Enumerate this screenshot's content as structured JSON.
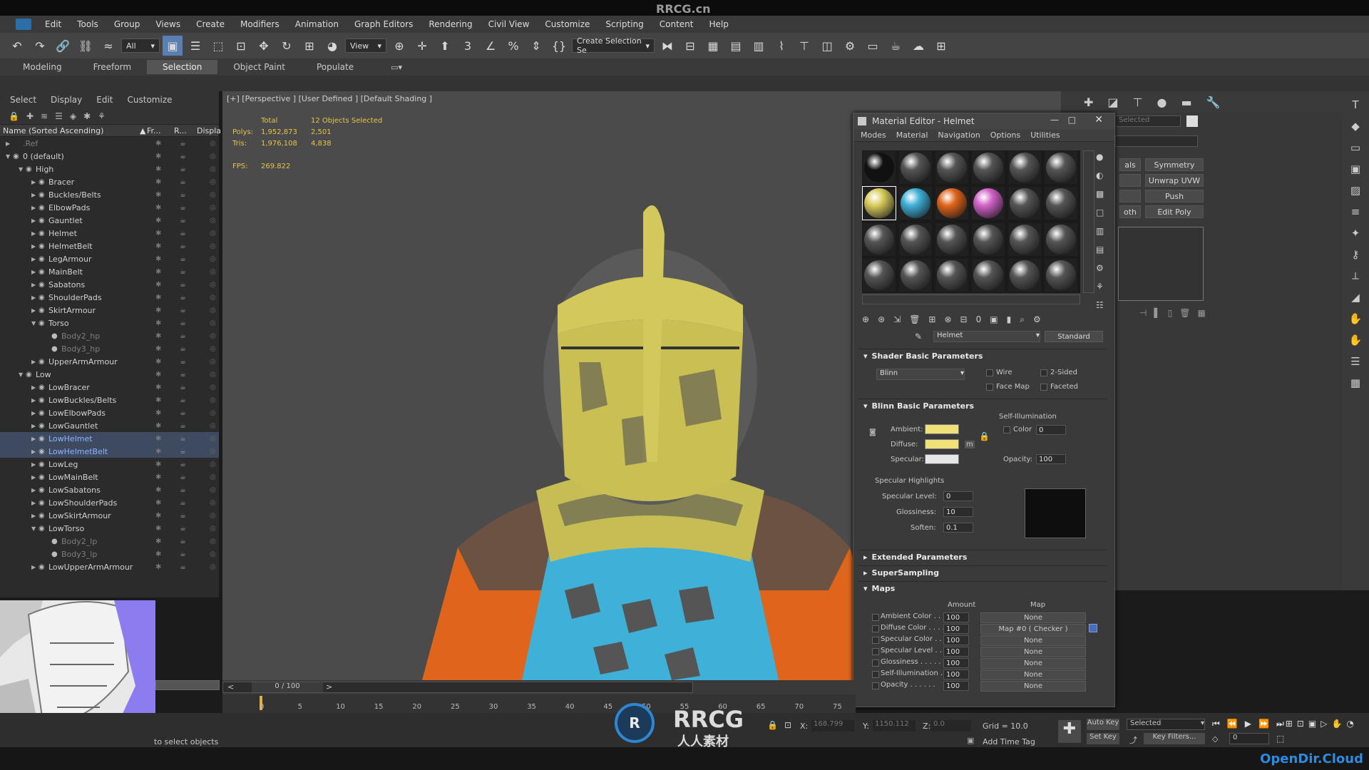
{
  "watermark_top": "RRCG.cn",
  "menubar": [
    "Edit",
    "Tools",
    "Group",
    "Views",
    "Create",
    "Modifiers",
    "Animation",
    "Graph Editors",
    "Rendering",
    "Civil View",
    "Customize",
    "Scripting",
    "Content",
    "Help"
  ],
  "toolbar": {
    "filter_value": "All",
    "view_value": "View",
    "selection_set": "Create Selection Se"
  },
  "ribbon_tabs": [
    "Modeling",
    "Freeform",
    "Selection",
    "Object Paint",
    "Populate"
  ],
  "ribbon_active": "Selection",
  "explorer": {
    "menu": [
      "Select",
      "Display",
      "Edit",
      "Customize"
    ],
    "col_name": "Name (Sorted Ascending)",
    "col_fr": "Fr...",
    "col_r": "R...",
    "col_disp": "Displa",
    "rows": [
      {
        "label": ".Ref",
        "indent": 0,
        "arrow": "▶",
        "eye": "",
        "cls": "dim"
      },
      {
        "label": "0 (default)",
        "indent": 0,
        "arrow": "▼",
        "eye": "◉",
        "cls": ""
      },
      {
        "label": "High",
        "indent": 1,
        "arrow": "▼",
        "eye": "◉",
        "cls": ""
      },
      {
        "label": "Bracer",
        "indent": 2,
        "arrow": "▶",
        "eye": "◉",
        "cls": ""
      },
      {
        "label": "Buckles/Belts",
        "indent": 2,
        "arrow": "▶",
        "eye": "◉",
        "cls": ""
      },
      {
        "label": "ElbowPads",
        "indent": 2,
        "arrow": "▶",
        "eye": "◉",
        "cls": ""
      },
      {
        "label": "Gauntlet",
        "indent": 2,
        "arrow": "▶",
        "eye": "◉",
        "cls": ""
      },
      {
        "label": "Helmet",
        "indent": 2,
        "arrow": "▶",
        "eye": "◉",
        "cls": ""
      },
      {
        "label": "HelmetBelt",
        "indent": 2,
        "arrow": "▶",
        "eye": "◉",
        "cls": ""
      },
      {
        "label": "LegArmour",
        "indent": 2,
        "arrow": "▶",
        "eye": "◉",
        "cls": ""
      },
      {
        "label": "MainBelt",
        "indent": 2,
        "arrow": "▶",
        "eye": "◉",
        "cls": ""
      },
      {
        "label": "Sabatons",
        "indent": 2,
        "arrow": "▶",
        "eye": "◉",
        "cls": ""
      },
      {
        "label": "ShoulderPads",
        "indent": 2,
        "arrow": "▶",
        "eye": "◉",
        "cls": ""
      },
      {
        "label": "SkirtArmour",
        "indent": 2,
        "arrow": "▶",
        "eye": "◉",
        "cls": ""
      },
      {
        "label": "Torso",
        "indent": 2,
        "arrow": "▼",
        "eye": "◉",
        "cls": ""
      },
      {
        "label": "Body2_hp",
        "indent": 3,
        "arrow": "",
        "eye": "●",
        "cls": "dim"
      },
      {
        "label": "Body3_hp",
        "indent": 3,
        "arrow": "",
        "eye": "●",
        "cls": "dim"
      },
      {
        "label": "UpperArmArmour",
        "indent": 2,
        "arrow": "▶",
        "eye": "◉",
        "cls": ""
      },
      {
        "label": "Low",
        "indent": 1,
        "arrow": "▼",
        "eye": "◉",
        "cls": ""
      },
      {
        "label": "LowBracer",
        "indent": 2,
        "arrow": "▶",
        "eye": "◉",
        "cls": ""
      },
      {
        "label": "LowBuckles/Belts",
        "indent": 2,
        "arrow": "▶",
        "eye": "◉",
        "cls": ""
      },
      {
        "label": "LowElbowPads",
        "indent": 2,
        "arrow": "▶",
        "eye": "◉",
        "cls": ""
      },
      {
        "label": "LowGauntlet",
        "indent": 2,
        "arrow": "▶",
        "eye": "◉",
        "cls": ""
      },
      {
        "label": "LowHelmet",
        "indent": 2,
        "arrow": "▶",
        "eye": "◉",
        "cls": "sel"
      },
      {
        "label": "LowHelmetBelt",
        "indent": 2,
        "arrow": "▶",
        "eye": "◉",
        "cls": "sel"
      },
      {
        "label": "LowLeg",
        "indent": 2,
        "arrow": "▶",
        "eye": "◉",
        "cls": ""
      },
      {
        "label": "LowMainBelt",
        "indent": 2,
        "arrow": "▶",
        "eye": "◉",
        "cls": ""
      },
      {
        "label": "LowSabatons",
        "indent": 2,
        "arrow": "▶",
        "eye": "◉",
        "cls": ""
      },
      {
        "label": "LowShoulderPads",
        "indent": 2,
        "arrow": "▶",
        "eye": "◉",
        "cls": ""
      },
      {
        "label": "LowSkirtArmour",
        "indent": 2,
        "arrow": "▶",
        "eye": "◉",
        "cls": ""
      },
      {
        "label": "LowTorso",
        "indent": 2,
        "arrow": "▼",
        "eye": "◉",
        "cls": ""
      },
      {
        "label": "Body2_lp",
        "indent": 3,
        "arrow": "",
        "eye": "●",
        "cls": "dim"
      },
      {
        "label": "Body3_lp",
        "indent": 3,
        "arrow": "",
        "eye": "●",
        "cls": "dim"
      },
      {
        "label": "LowUpperArmArmour",
        "indent": 2,
        "arrow": "▶",
        "eye": "◉",
        "cls": ""
      }
    ]
  },
  "viewport": {
    "label": "[+] [Perspective ] [User Defined ] [Default Shading ]",
    "total_label": "Total",
    "selected_label": "12 Objects Selected",
    "polys_label": "Polys:",
    "polys_total": "1,952,873",
    "polys_sel": "2,501",
    "tris_label": "Tris:",
    "tris_total": "1,976,108",
    "tris_sel": "4,838",
    "fps_label": "FPS:",
    "fps": "269.822"
  },
  "material_editor": {
    "title": "Material Editor - Helmet",
    "menu": [
      "Modes",
      "Material",
      "Navigation",
      "Options",
      "Utilities"
    ],
    "material_name": "Helmet",
    "material_type": "Standard",
    "shader_rollout": "Shader Basic Parameters",
    "shader_value": "Blinn",
    "wire": "Wire",
    "two_sided": "2-Sided",
    "face_map": "Face Map",
    "faceted": "Faceted",
    "blinn_rollout": "Blinn Basic Parameters",
    "self_illum": "Self-Illumination",
    "color_label": "Color",
    "color_value": "0",
    "ambient": "Ambient:",
    "diffuse": "Diffuse:",
    "specular": "Specular:",
    "m_label": "m",
    "opacity_label": "Opacity:",
    "opacity_value": "100",
    "spec_highlights": "Specular Highlights",
    "spec_level_label": "Specular Level:",
    "spec_level": "0",
    "glossiness_label": "Glossiness:",
    "glossiness": "10",
    "soften_label": "Soften:",
    "soften": "0.1",
    "extended": "Extended Parameters",
    "supersampling": "SuperSampling",
    "maps": "Maps",
    "amount_hdr": "Amount",
    "map_hdr": "Map",
    "map_rows": [
      {
        "label": "Ambient Color . . .",
        "amount": "100",
        "map": "None"
      },
      {
        "label": "Diffuse Color . . . .",
        "amount": "100",
        "map": "Map #0  ( Checker )"
      },
      {
        "label": "Specular Color . .",
        "amount": "100",
        "map": "None"
      },
      {
        "label": "Specular Level . .",
        "amount": "100",
        "map": "None"
      },
      {
        "label": "Glossiness . . . . .",
        "amount": "100",
        "map": "None"
      },
      {
        "label": "Self-Illumination . .",
        "amount": "100",
        "map": "None"
      },
      {
        "label": "Opacity . . . . . .",
        "amount": "100",
        "map": "None"
      }
    ],
    "colors": {
      "ambient": "#f0e07a",
      "diffuse": "#f0e07a",
      "specular": "#e6e6e6"
    },
    "spheres": [
      "#111111",
      "#555555",
      "#555555",
      "#555555",
      "#555555",
      "#555555",
      "#d8cc5c",
      "#3fb0d8",
      "#e0651c",
      "#d262c8",
      "#555555",
      "#555555",
      "#555555",
      "#555555",
      "#555555",
      "#555555",
      "#555555",
      "#555555",
      "#555555",
      "#555555",
      "#555555",
      "#555555",
      "#555555",
      "#555555"
    ]
  },
  "command_panel": {
    "selected_placeholder": "Selected",
    "buttons": [
      {
        "left": "als",
        "right": "Symmetry"
      },
      {
        "left": "",
        "right": "Unwrap UVW"
      },
      {
        "left": "",
        "right": "Push"
      },
      {
        "left": "oth",
        "right": "Edit Poly"
      }
    ]
  },
  "timeline": {
    "frame": "0 / 100",
    "ticks": [
      "0",
      "5",
      "10",
      "15",
      "20",
      "25",
      "30",
      "35",
      "40",
      "45",
      "50",
      "55",
      "60",
      "65",
      "70",
      "75"
    ]
  },
  "status": {
    "prompt": "to select objects",
    "x_label": "X:",
    "x_value": "168.799",
    "y_label": "Y:",
    "y_value": "1150.112",
    "z_label": "Z:",
    "z_value": "0.0",
    "grid": "Grid = 10.0",
    "add_time_tag": "Add Time Tag",
    "auto_key": "Auto Key",
    "selected_dd": "Selected",
    "set_key": "Set Key",
    "key_filters": "Key Filters...",
    "frame_field": "0"
  },
  "watermarks": {
    "center_logo": "RRCG",
    "center_sub": "人人素材",
    "bottom_right": "OpenDir.Cloud"
  }
}
